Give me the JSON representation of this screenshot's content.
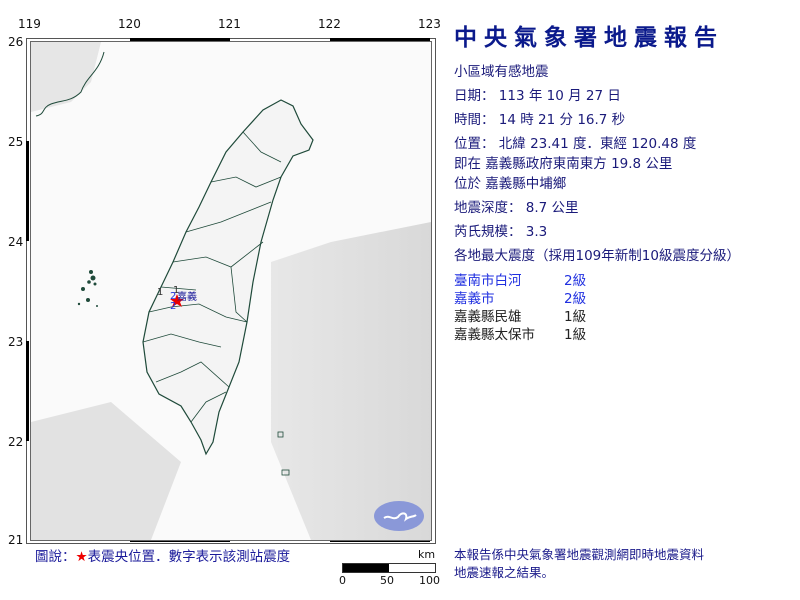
{
  "map": {
    "lon_ticks": [
      "119",
      "120",
      "121",
      "122",
      "123"
    ],
    "lat_ticks": [
      "26",
      "25",
      "24",
      "23",
      "22",
      "21"
    ],
    "epicenter_label": "嘉義",
    "station_marks": [
      {
        "value": "1",
        "color": "#333333"
      },
      {
        "value": "1",
        "color": "#333333"
      },
      {
        "value": "2",
        "color": "#2030e0"
      },
      {
        "value": "2",
        "color": "#2030e0"
      }
    ],
    "scale": {
      "unit": "km",
      "ticks": [
        "0",
        "50",
        "100"
      ]
    },
    "legend": {
      "prefix": "圖說：",
      "star": "★",
      "text": "表震央位置．數字表示該測站震度"
    }
  },
  "report": {
    "title": "中央氣象署地震報告",
    "subtitle": "小區域有感地震",
    "date_line": "日期： 113 年 10 月 27 日",
    "time_line": "時間： 14 時 21 分 16.7 秒",
    "position_line": "位置： 北緯 23.41 度．東經 120.48 度",
    "relative_line": "即在 嘉義縣政府東南東方 19.8 公里",
    "located_line": "位於 嘉義縣中埔鄉",
    "depth_line": "地震深度： 8.7 公里",
    "magnitude_line": "芮氏規模： 3.3",
    "intensity_heading": "各地最大震度（採用109年新制10級震度分級）",
    "intensities": [
      {
        "location": "臺南市白河",
        "level": "2級",
        "highlight": true
      },
      {
        "location": "嘉義市",
        "level": "2級",
        "highlight": true
      },
      {
        "location": "嘉義縣民雄",
        "level": "1級",
        "highlight": false
      },
      {
        "location": "嘉義縣太保市",
        "level": "1級",
        "highlight": false
      }
    ],
    "footer_note_1": "本報告係中央氣象署地震觀測網即時地震資料",
    "footer_note_2": "地震速報之結果。"
  },
  "colors": {
    "title": "#0b1a8c",
    "highlight": "#2030e0",
    "epicenter": "#ee0000",
    "coast": "#1f4a3a"
  }
}
